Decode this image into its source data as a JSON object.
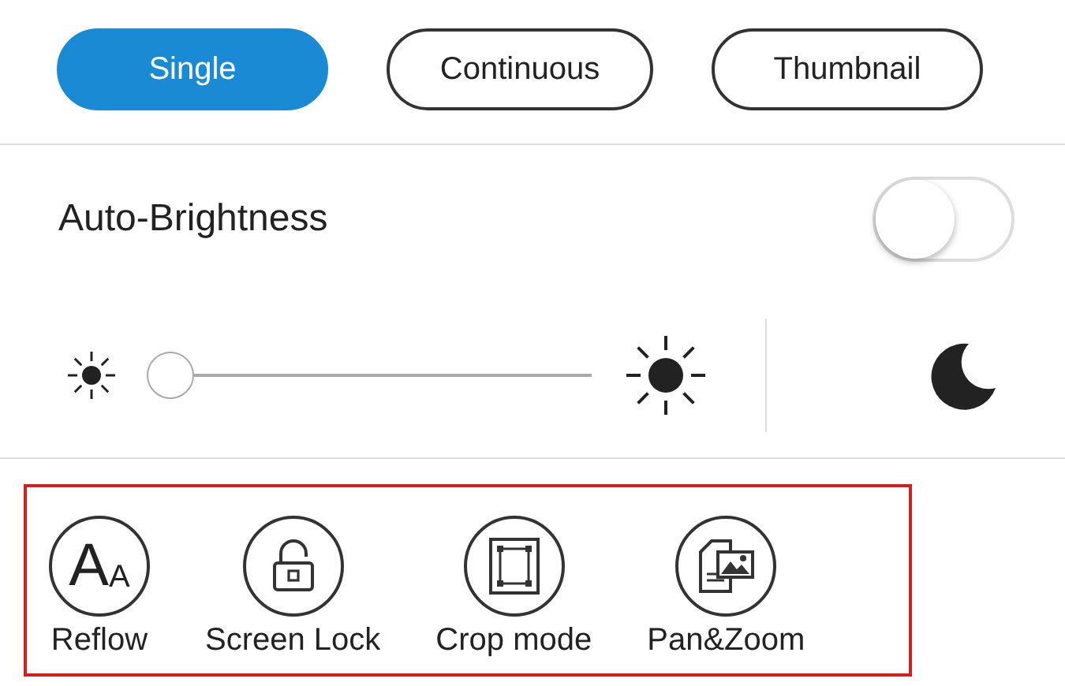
{
  "view_modes": [
    {
      "label": "Single",
      "selected": true
    },
    {
      "label": "Continuous",
      "selected": false
    },
    {
      "label": "Thumbnail",
      "selected": false
    }
  ],
  "auto_brightness": {
    "label": "Auto-Brightness",
    "on": false
  },
  "brightness": {
    "level": 0
  },
  "tools_highlighted": true,
  "tools": [
    {
      "kind": "reflow",
      "label": "Reflow",
      "glyph_large": "A",
      "glyph_small": "A"
    },
    {
      "kind": "lock",
      "label": "Screen Lock"
    },
    {
      "kind": "crop",
      "label": "Crop mode"
    },
    {
      "kind": "panzoom",
      "label": "Pan&Zoom"
    }
  ]
}
